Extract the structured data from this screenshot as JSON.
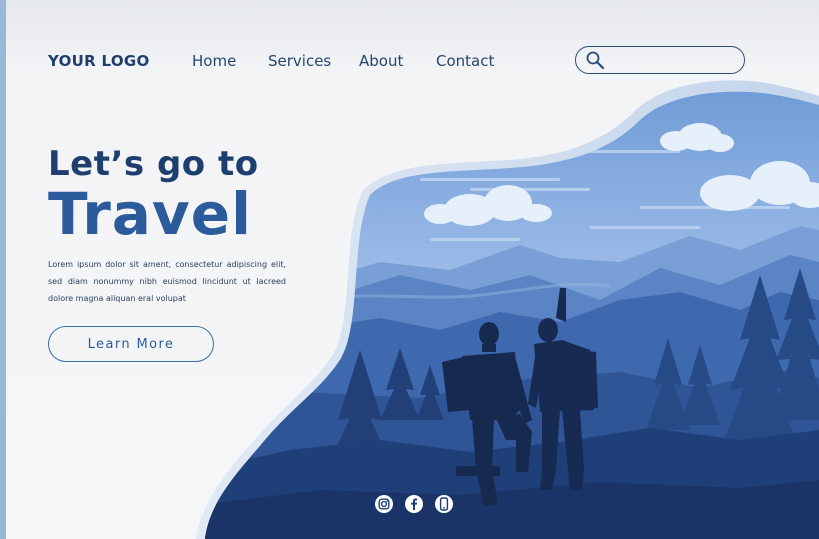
{
  "header": {
    "logo": "YOUR LOGO",
    "nav": [
      "Home",
      "Services",
      "About",
      "Contact"
    ],
    "search_placeholder": "",
    "search_icon": "search-icon"
  },
  "hero": {
    "line1": "Let’s go to",
    "line2": "Travel",
    "body": "Lorem ipsum dolor sit ament, consectetur adipiscing elit, sed diam nonummy nibh euismod lincidunt ut lacreed dolore magna aliquan eral volupat",
    "button_label": "Learn More"
  },
  "social": {
    "icons": [
      "instagram-icon",
      "facebook-icon",
      "phone-icon"
    ]
  },
  "colors": {
    "brand_dark": "#1e3f6e",
    "brand_accent": "#2c5b9c",
    "sky": "#8fb3e4",
    "mountains": "#3e69ae",
    "forest": "#1f3f78"
  }
}
